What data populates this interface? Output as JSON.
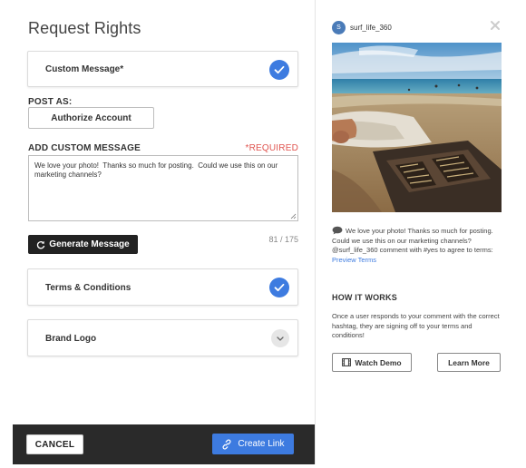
{
  "left": {
    "title": "Request Rights",
    "custom_message_card": {
      "label": "Custom Message*",
      "status_icon": "checkmark-icon"
    },
    "post_as": {
      "label": "POST AS:",
      "button_label": "Authorize Account"
    },
    "add_custom_message": {
      "label": "ADD CUSTOM MESSAGE",
      "required_label": "*REQUIRED",
      "value": "We love your photo!  Thanks so much for posting.  Could we use this on our marketing channels?",
      "counter": "81 / 175"
    },
    "generate_button": {
      "label": "Generate Message",
      "icon": "refresh-icon"
    },
    "terms_card": {
      "label": "Terms & Conditions",
      "status_icon": "checkmark-icon"
    },
    "brand_logo_card": {
      "label": "Brand Logo",
      "status_icon": "chevron-down-icon"
    },
    "footer": {
      "cancel_label": "CANCEL",
      "create_label": "Create Link",
      "create_icon": "link-icon"
    }
  },
  "right": {
    "avatar_initial": "S",
    "username": "surf_life_360",
    "close_icon": "close-icon",
    "photo_icon": "beach-backgammon-photo",
    "caption": {
      "text": "We love your photo! Thanks so much for posting. Could we use this on our marketing channels?  @surf_life_360 comment with #yes to agree to terms: ",
      "link": "Preview Terms"
    },
    "how_it_works": {
      "title": "HOW IT WORKS",
      "text": "Once a user responds to your comment with the correct hashtag, they are signing off to your terms and conditions!"
    },
    "watch_demo_label": "Watch Demo",
    "learn_more_label": "Learn More"
  },
  "colors": {
    "accent": "#3d7be0",
    "required": "#e0544f",
    "footer": "#2a2a2a",
    "generate_button": "#222222"
  }
}
